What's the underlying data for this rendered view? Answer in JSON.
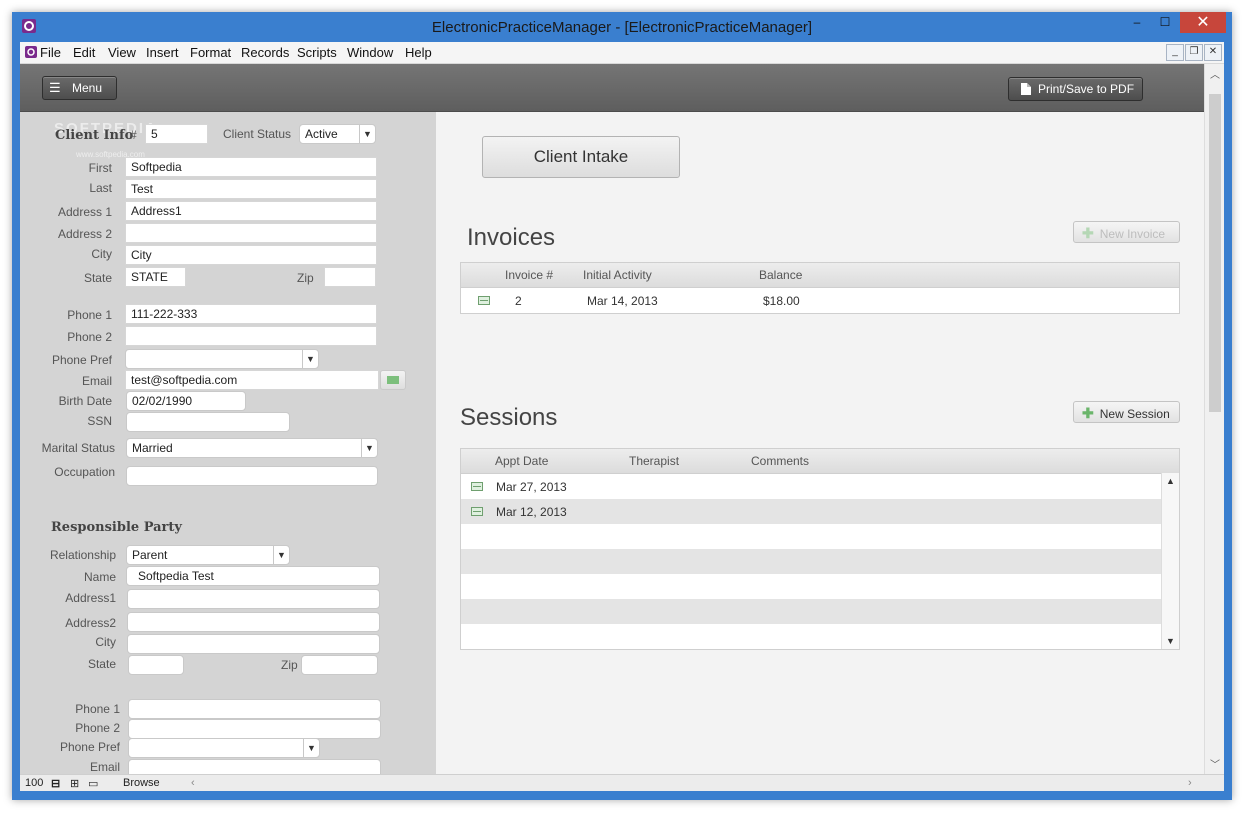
{
  "window": {
    "title": "ElectronicPracticeManager - [ElectronicPracticeManager]",
    "min": "–",
    "max": "☐",
    "close": "✕"
  },
  "menubar": {
    "items": [
      "File",
      "Edit",
      "View",
      "Insert",
      "Format",
      "Records",
      "Scripts",
      "Window",
      "Help"
    ],
    "mdi_min": "_",
    "mdi_restore": "❐",
    "mdi_close": "✕"
  },
  "toolbar": {
    "menu_label": "Menu",
    "print_label": "Print/Save to PDF"
  },
  "client_info": {
    "title": "Client Info",
    "number_label": "#",
    "number": "5",
    "status_label": "Client Status",
    "status": "Active",
    "first_label": "First",
    "first": "Softpedia",
    "last_label": "Last",
    "last": "Test",
    "address1_label": "Address 1",
    "address1": "Address1",
    "address2_label": "Address 2",
    "address2": "",
    "city_label": "City",
    "city": "City",
    "state_label": "State",
    "state": "STATE",
    "zip_label": "Zip",
    "zip": "",
    "phone1_label": "Phone 1",
    "phone1": "111-222-333",
    "phone2_label": "Phone 2",
    "phone2": "",
    "phonepref_label": "Phone Pref",
    "phonepref": "",
    "email_label": "Email",
    "email": "test@softpedia.com",
    "birth_label": "Birth Date",
    "birth": "02/02/1990",
    "ssn_label": "SSN",
    "ssn": "",
    "marital_label": "Marital Status",
    "marital": "Married",
    "occupation_label": "Occupation",
    "occupation": ""
  },
  "responsible": {
    "title": "Responsible Party",
    "relationship_label": "Relationship",
    "relationship": "Parent",
    "name_label": "Name",
    "name": "Softpedia Test",
    "address1_label": "Address1",
    "address1": "",
    "address2_label": "Address2",
    "address2": "",
    "city_label": "City",
    "city": "",
    "state_label": "State",
    "state": "",
    "zip_label": "Zip",
    "zip": "",
    "phone1_label": "Phone 1",
    "phone1": "",
    "phone2_label": "Phone 2",
    "phone2": "",
    "phonepref_label": "Phone Pref",
    "phonepref": "",
    "email_label": "Email",
    "email": ""
  },
  "watermark": {
    "text": "SOFTPEDIA",
    "url": "www.softpedia.com"
  },
  "main": {
    "intake_label": "Client Intake",
    "invoices": {
      "title": "Invoices",
      "new_label": "New Invoice",
      "headers": [
        "Invoice #",
        "Initial Activity",
        "Balance"
      ],
      "rows": [
        {
          "number": "2",
          "date": "Mar 14, 2013",
          "balance": "$18.00"
        }
      ]
    },
    "sessions": {
      "title": "Sessions",
      "new_label": "New Session",
      "headers": [
        "Appt Date",
        "Therapist",
        "Comments"
      ],
      "rows": [
        {
          "date": "Mar 27, 2013"
        },
        {
          "date": "Mar 12, 2013"
        }
      ]
    }
  },
  "status_bar": {
    "zoom": "100",
    "mode": "Browse"
  },
  "colors": {
    "titlebar": "#3a7fcf",
    "close": "#c7463b",
    "header": "#666666",
    "left_panel": "#d4d4d4",
    "accent_green": "#6bb56b"
  }
}
